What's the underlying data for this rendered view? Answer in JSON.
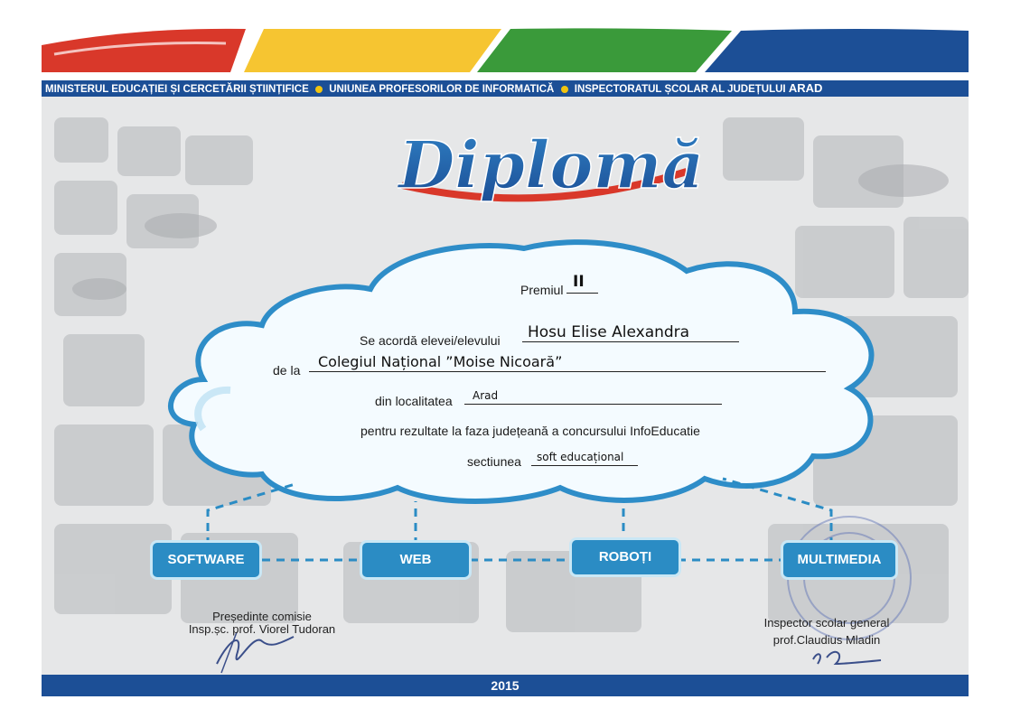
{
  "header": {
    "org1": "MINISTERUL EDUCAȚIEI ȘI CERCETĂRII ȘTIINȚIFICE",
    "org2": "UNIUNEA PROFESORILOR DE INFORMATICĂ",
    "org3_prefix": "INSPECTORATUL ȘCOLAR AL JUDEȚULUI",
    "org3_city": "ARAD"
  },
  "title": "Diplomă",
  "body": {
    "premiul_label": "Premiul",
    "premiul_value": "II",
    "elev_label": "Se acordă elevei/elevului",
    "elev_value": "Hosu Elise Alexandra",
    "scoala_label": "de la",
    "scoala_value": "Colegiul Național ”Moise Nicoară”",
    "localitate_label": "din localitatea",
    "localitate_value": "Arad",
    "rezultate_text": "pentru rezultate la faza județeană a concursului InfoEducatie",
    "sectiune_label": "sectiunea",
    "sectiune_value": "soft educațional"
  },
  "categories": [
    "SOFTWARE",
    "WEB",
    "ROBOȚI",
    "MULTIMEDIA"
  ],
  "signatures": {
    "left_role": "Președinte comisie",
    "left_name": "Insp.șc. prof. Viorel Tudoran",
    "right_role": "Inspector scolar general",
    "right_name": "prof.Claudius Mladin"
  },
  "footer": {
    "year": "2015"
  },
  "colors": {
    "red": "#d9382a",
    "yellow": "#f6c531",
    "green": "#3a9a3a",
    "blue": "#1c4f96",
    "cloud_border": "#2e8dc8",
    "node": "#2b8cc4"
  }
}
